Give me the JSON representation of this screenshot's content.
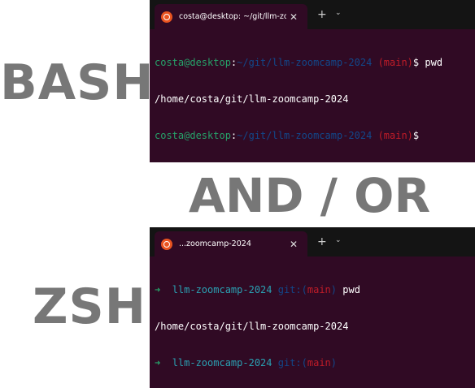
{
  "labels": {
    "bash": "BASH",
    "and_or": "AND / OR",
    "zsh": "ZSH"
  },
  "bash_terminal": {
    "tab_title": "costa@desktop: ~/git/llm-zoc",
    "tab_close": "✕",
    "tab_add": "+",
    "tab_dropdown": "⌄",
    "lines": [
      {
        "user_host": "costa@desktop",
        "colon": ":",
        "path": "~/git/llm-zoomcamp-2024",
        "branch": "(main)",
        "prompt_symbol": "$",
        "command": "pwd"
      },
      {
        "output": "/home/costa/git/llm-zoomcamp-2024"
      },
      {
        "user_host": "costa@desktop",
        "colon": ":",
        "path": "~/git/llm-zoomcamp-2024",
        "branch": "(main)",
        "prompt_symbol": "$",
        "command": ""
      }
    ]
  },
  "zsh_terminal": {
    "tab_title": "...zoomcamp-2024",
    "tab_close": "✕",
    "tab_add": "+",
    "tab_dropdown": "⌄",
    "lines": [
      {
        "arrow": "➜",
        "dir": "llm-zoomcamp-2024",
        "git_prefix": "git:(",
        "branch": "main",
        "git_suffix": ")",
        "command": "pwd"
      },
      {
        "output": "/home/costa/git/llm-zoomcamp-2024"
      },
      {
        "arrow": "➜",
        "dir": "llm-zoomcamp-2024",
        "git_prefix": "git:(",
        "branch": "main",
        "git_suffix": ")",
        "command": ""
      }
    ]
  },
  "colors": {
    "terminal_bg": "#300a24",
    "tabbar_bg": "#141414",
    "prompt_green": "#26a269",
    "path_blue": "#12488b",
    "branch_red": "#c01c28",
    "zsh_cyan": "#2aa1b3",
    "label_gray": "#777777",
    "ubuntu_orange": "#e95420"
  }
}
